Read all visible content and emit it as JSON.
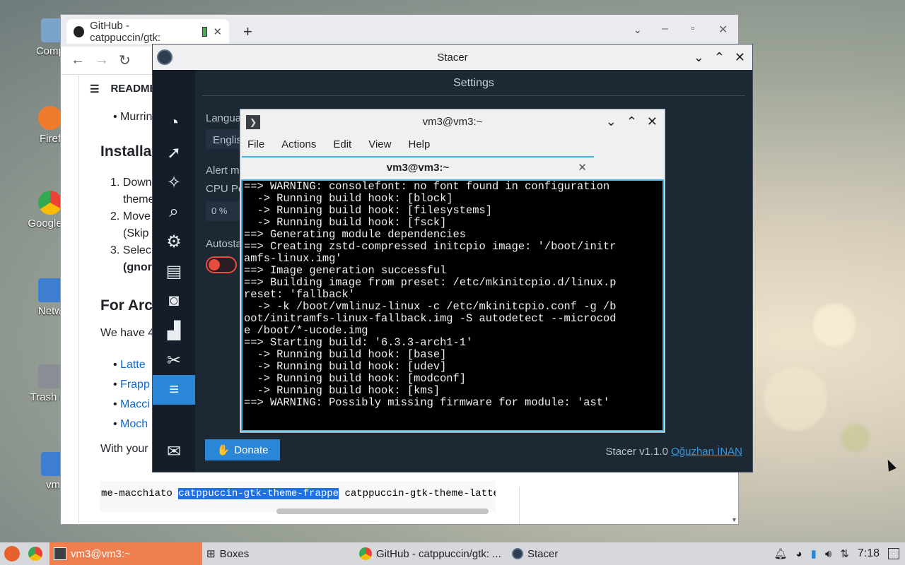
{
  "desktop": {
    "icons": [
      {
        "label": "Compu",
        "color": "#7aa4c9"
      },
      {
        "label": "Firef",
        "color": "#f07b2c"
      },
      {
        "label": "Google C",
        "color": "#ea4335"
      },
      {
        "label": "Netw",
        "color": "#3d7ed1"
      },
      {
        "label": "Trash (E",
        "color": "#8a8f96"
      },
      {
        "label": "vm",
        "color": "#3d7ed1"
      }
    ]
  },
  "browser": {
    "tab_title": "GitHub - catppuccin/gtk: ",
    "readme_label": "README",
    "list_item_top": "Murrin",
    "heading_install": "Installat",
    "steps": [
      "Down",
      "theme",
      "Move",
      "(Skip",
      "Selec",
      "(gnor"
    ],
    "heading_arch": "For Arc",
    "we_have": "We have 4",
    "flavors": [
      "Latte",
      "Frapp",
      "Macci",
      "Moch"
    ],
    "with_your": "With your",
    "code_left": "me-macchiato ",
    "code_selected": "catppuccin-gtk-theme-frappe",
    "code_right": " catppuccin-gtk-theme-latte"
  },
  "stacer": {
    "title": "Stacer",
    "header": "Settings",
    "language_label": "Langua",
    "language_value": "Englis",
    "alert_label": "Alert m",
    "cpu_label": "CPU Pe",
    "cpu_value": "0 %",
    "autostart_label": "Autosta",
    "autostart_enabled": false,
    "donate_label": "Donate",
    "version_text": "Stacer v1.1.0",
    "author_link": "Oğuzhan İNAN",
    "sidebar_active_index": 9
  },
  "terminal": {
    "title": "vm3@vm3:~",
    "menu": [
      "File",
      "Actions",
      "Edit",
      "View",
      "Help"
    ],
    "tab_title": "vm3@vm3:~",
    "output": "==> WARNING: consolefont: no font found in configuration\n  -> Running build hook: [block]\n  -> Running build hook: [filesystems]\n  -> Running build hook: [fsck]\n==> Generating module dependencies\n==> Creating zstd-compressed initcpio image: '/boot/initr\namfs-linux.img'\n==> Image generation successful\n==> Building image from preset: /etc/mkinitcpio.d/linux.p\nreset: 'fallback'\n  -> -k /boot/vmlinuz-linux -c /etc/mkinitcpio.conf -g /b\noot/initramfs-linux-fallback.img -S autodetect --microcod\ne /boot/*-ucode.img\n==> Starting build: '6.3.3-arch1-1'\n  -> Running build hook: [base]\n  -> Running build hook: [udev]\n  -> Running build hook: [modconf]\n  -> Running build hook: [kms]\n==> WARNING: Possibly missing firmware for module: 'ast'"
  },
  "taskbar": {
    "items": [
      "vm3@vm3:~",
      "Boxes",
      "GitHub - catppuccin/gtk: ...",
      "Stacer"
    ],
    "active_index": 0,
    "clock": "7:18"
  },
  "colors": {
    "accent": "#2a86d6",
    "terminal_active_border": "#3daee9",
    "taskbar_active": "#f07f4f"
  }
}
